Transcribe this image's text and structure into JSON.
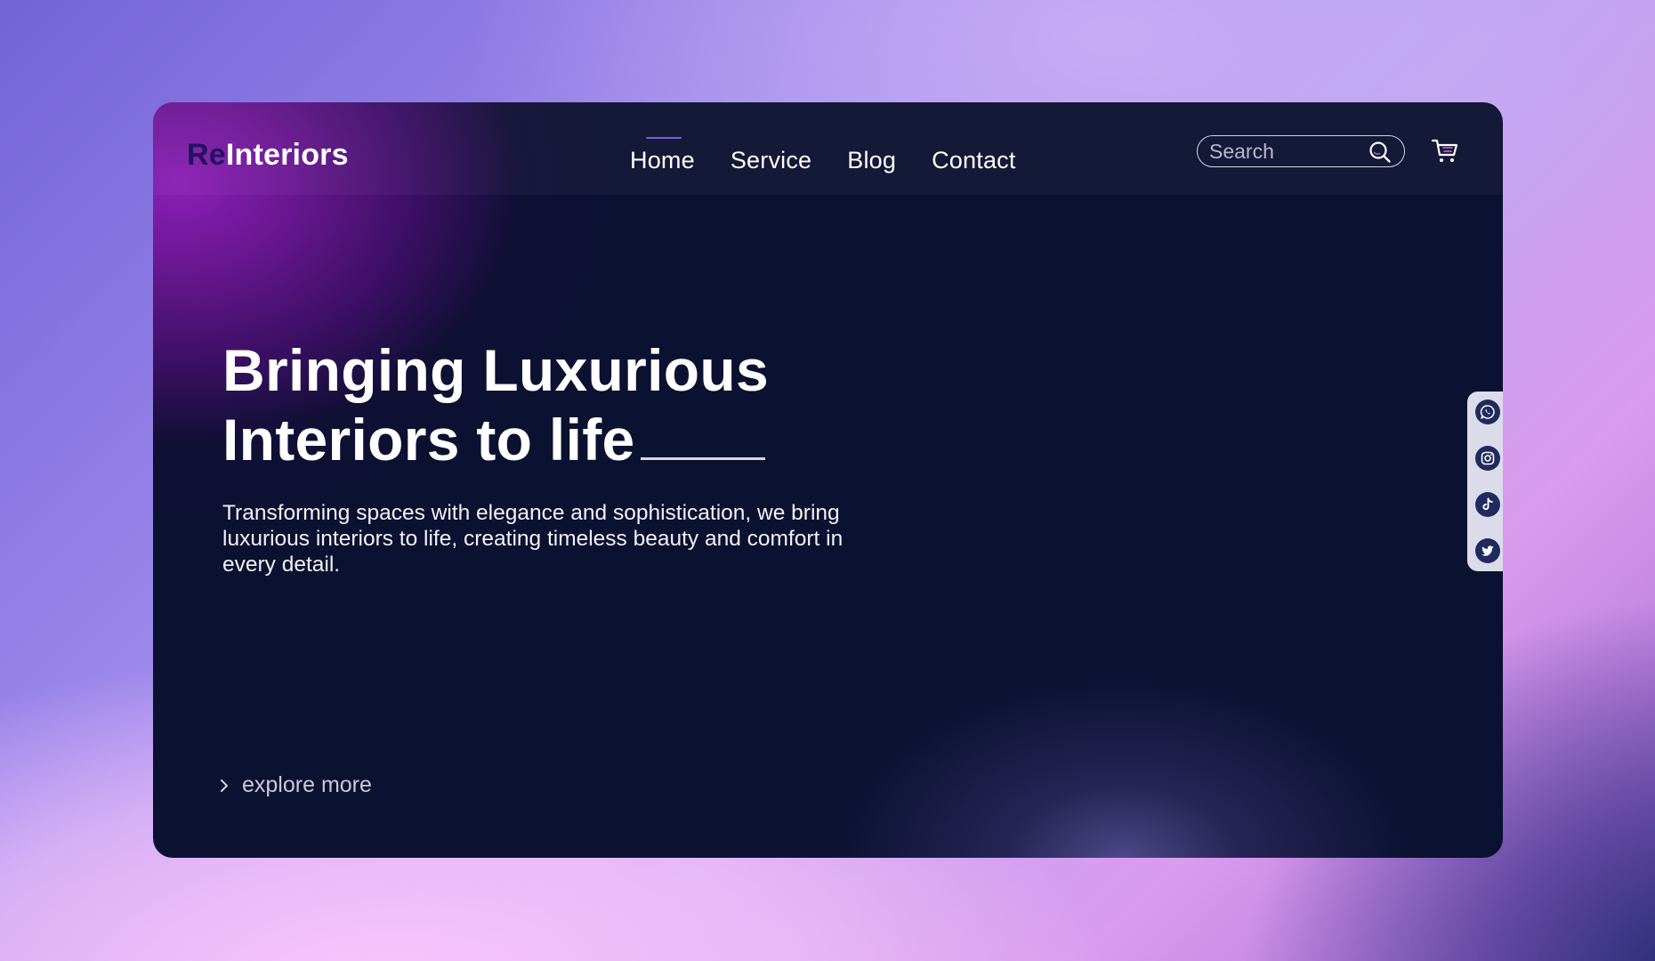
{
  "brand": {
    "prefix": "Re",
    "name": "Interiors"
  },
  "nav": {
    "items": [
      {
        "label": "Home",
        "active": true
      },
      {
        "label": "Service",
        "active": false
      },
      {
        "label": "Blog",
        "active": false
      },
      {
        "label": "Contact",
        "active": false
      }
    ]
  },
  "search": {
    "placeholder": "Search",
    "value": ""
  },
  "hero": {
    "title_line1": "Bringing Luxurious",
    "title_line2": "Interiors to life",
    "description": "Transforming spaces with elegance and sophistication, we bring luxurious interiors to life, creating timeless beauty and comfort in every detail."
  },
  "cta": {
    "label": "explore more"
  },
  "social": [
    "whatsapp-icon",
    "instagram-icon",
    "tiktok-icon",
    "twitter-icon"
  ],
  "colors": {
    "background_card": "#0b1130",
    "accent_purple": "#8a1fb6",
    "nav_active_bar": "#7b5de0",
    "social_bar": "#dcdbea",
    "social_button": "#1f2a5e"
  }
}
